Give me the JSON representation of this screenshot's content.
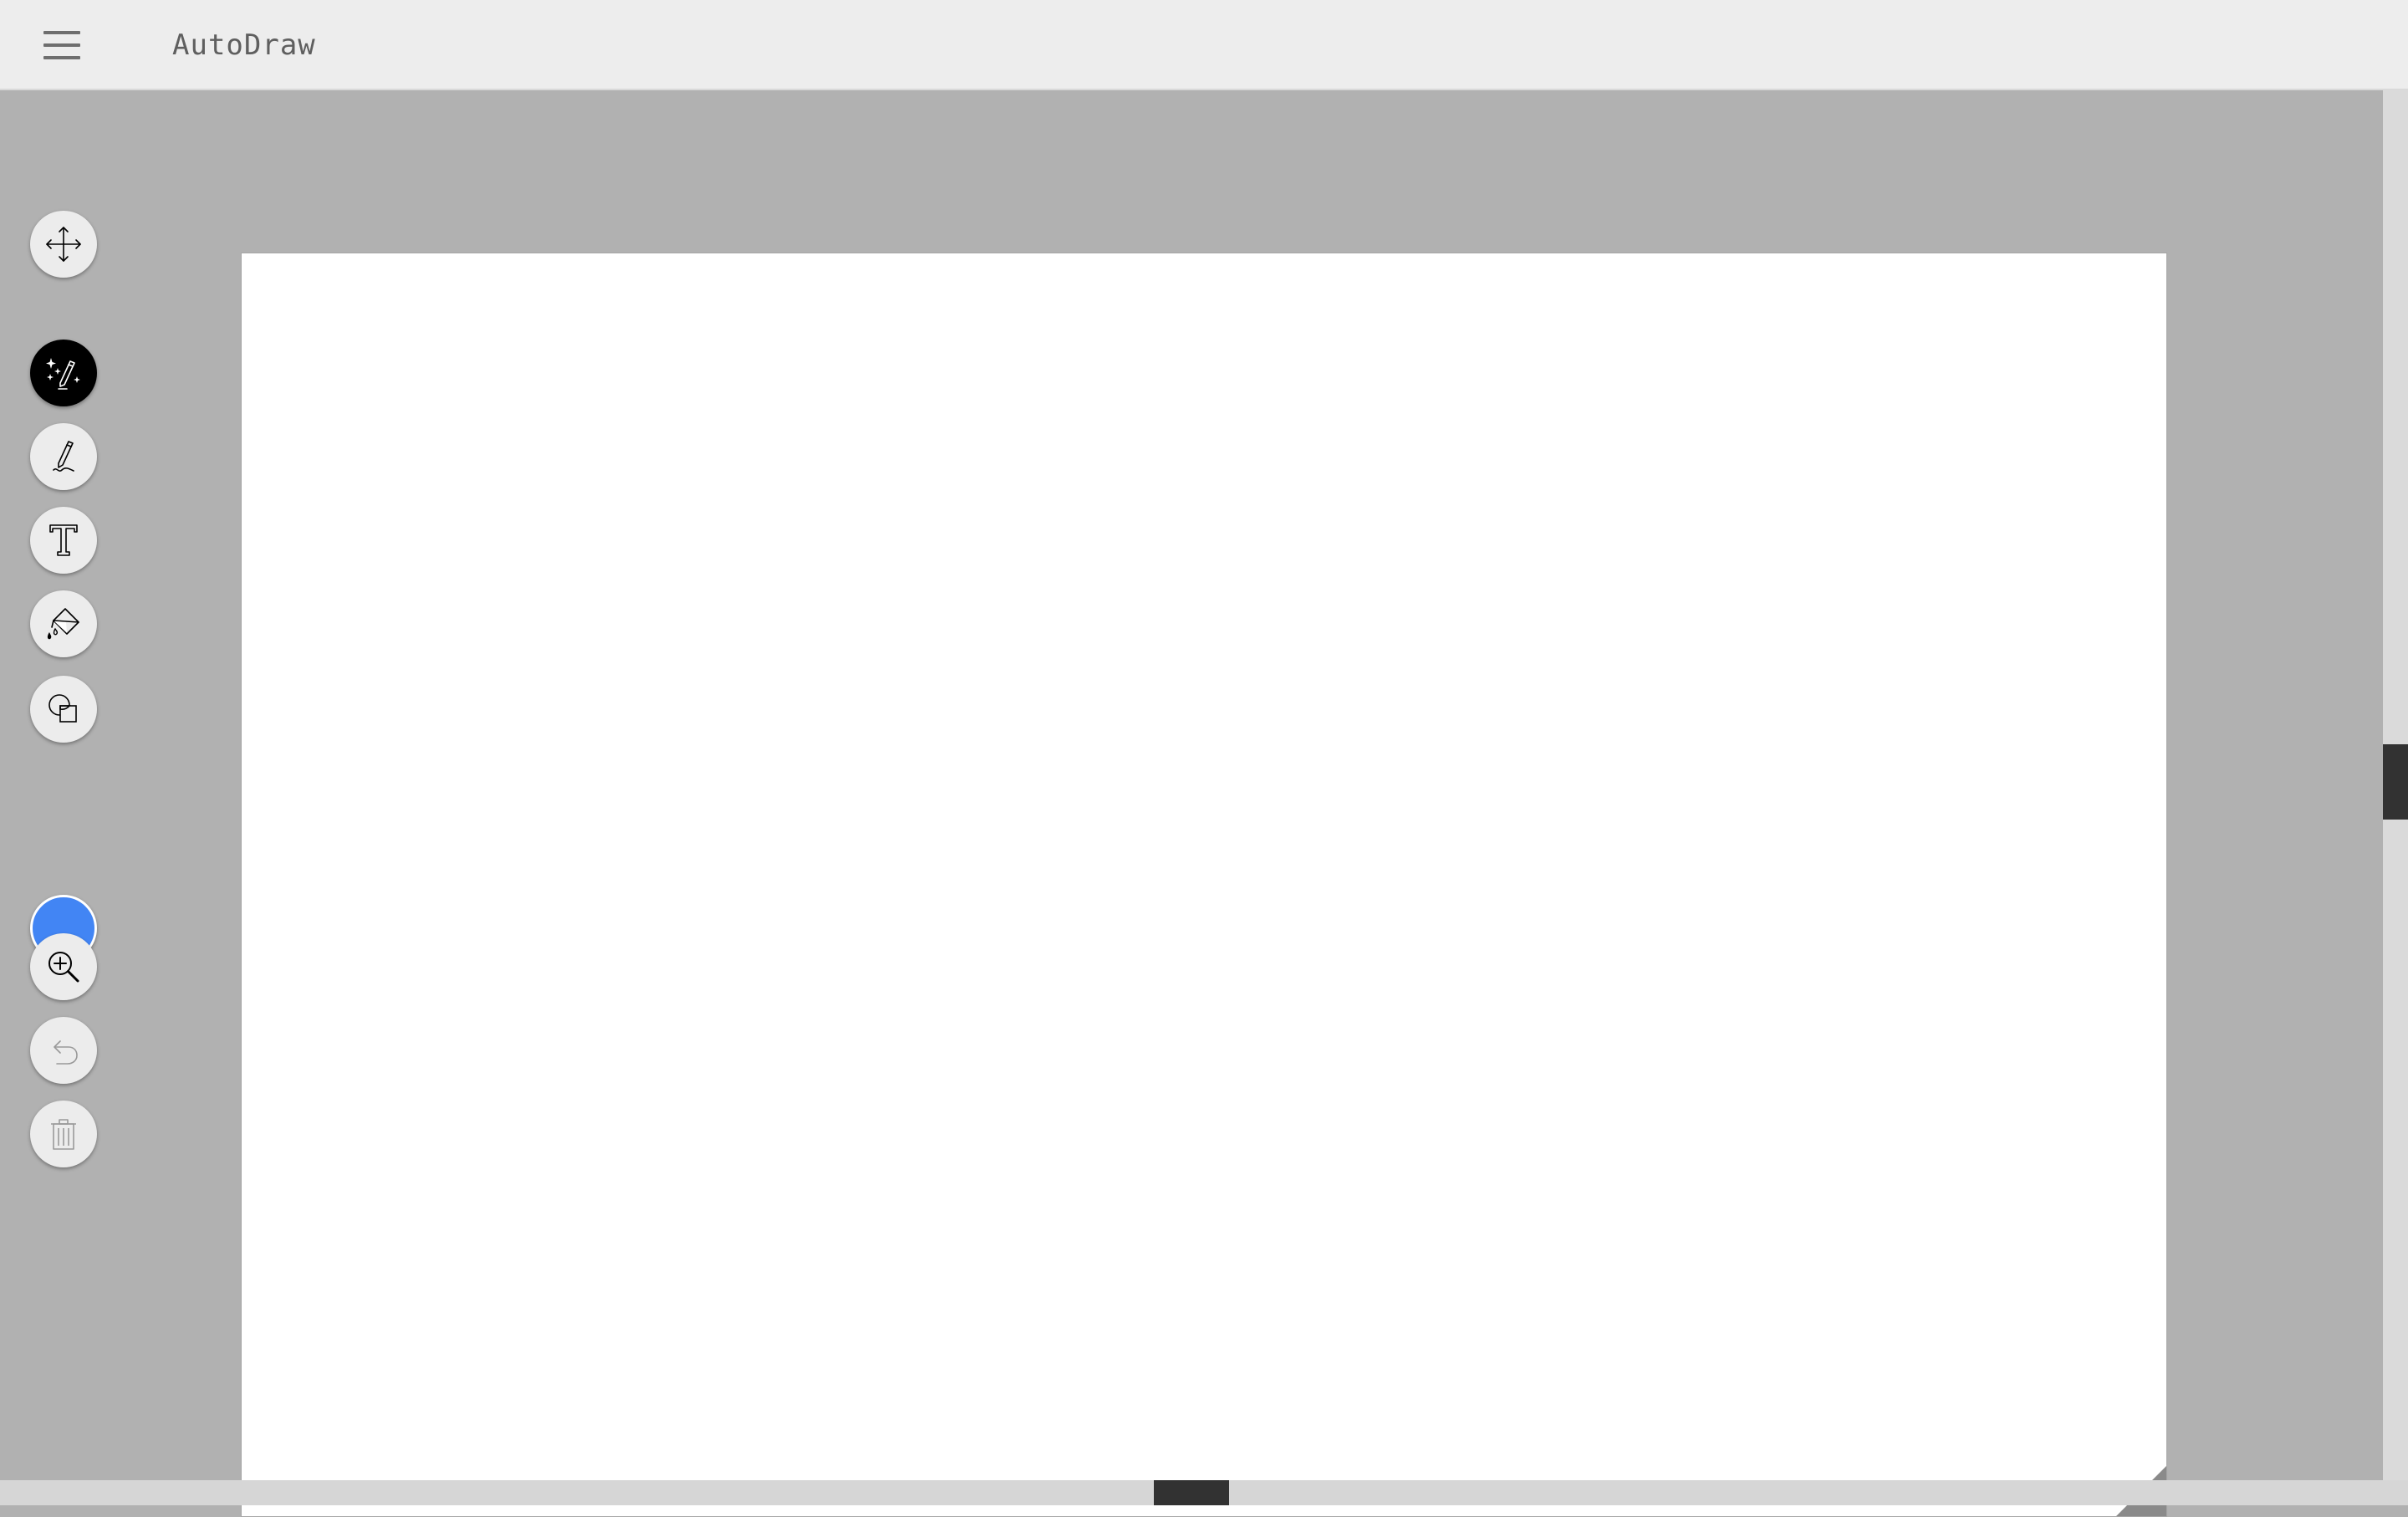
{
  "header": {
    "title": "AutoDraw",
    "menu_icon": "hamburger-menu-icon"
  },
  "toolbar": {
    "tools": [
      {
        "id": "move",
        "icon": "move-arrows-icon",
        "active": false,
        "enabled": true
      },
      {
        "id": "autodraw",
        "icon": "magic-pencil-sparkles-icon",
        "active": true,
        "enabled": true
      },
      {
        "id": "draw",
        "icon": "pencil-icon",
        "active": false,
        "enabled": true
      },
      {
        "id": "type",
        "icon": "text-t-icon",
        "active": false,
        "enabled": true
      },
      {
        "id": "fill",
        "icon": "paint-bucket-icon",
        "active": false,
        "enabled": true
      },
      {
        "id": "shape",
        "icon": "shapes-icon",
        "active": false,
        "enabled": true
      },
      {
        "id": "zoom",
        "icon": "zoom-in-icon",
        "active": false,
        "enabled": true
      },
      {
        "id": "undo",
        "icon": "undo-icon",
        "active": false,
        "enabled": false
      },
      {
        "id": "delete",
        "icon": "trash-icon",
        "active": false,
        "enabled": false
      }
    ],
    "selected_color": "#4285f4"
  },
  "colors": {
    "topbar": "#ededed",
    "workspace": "#b1b1b1",
    "canvas": "#ffffff",
    "active_tool": "#000000"
  }
}
